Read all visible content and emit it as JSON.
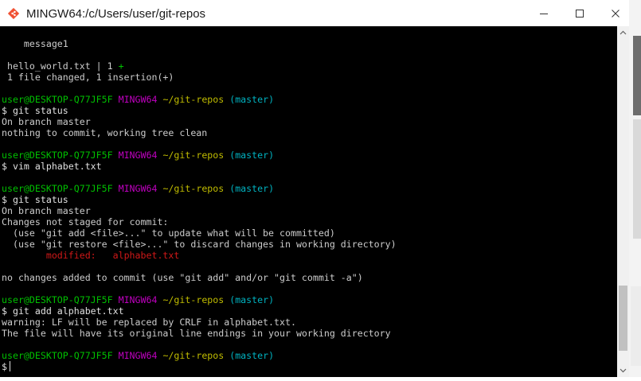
{
  "window": {
    "title": "MINGW64:/c/Users/user/git-repos",
    "controls": {
      "minimize": "minimize",
      "maximize": "maximize",
      "close": "close"
    }
  },
  "colors": {
    "user_host": "#00c100",
    "mingw": "#c000c0",
    "path": "#c0bc00",
    "branch": "#00b2c0",
    "modified": "#d01818"
  },
  "terminal": {
    "lines": [
      [
        {
          "t": "    message1",
          "c": ""
        }
      ],
      [
        {
          "t": "",
          "c": ""
        }
      ],
      [
        {
          "t": " hello_world.txt | 1 ",
          "c": ""
        },
        {
          "t": "+",
          "c": "c-green"
        }
      ],
      [
        {
          "t": " 1 file changed, 1 insertion(+)",
          "c": ""
        }
      ],
      [
        {
          "t": "",
          "c": ""
        }
      ],
      [
        {
          "t": "user@DESKTOP-Q77JF5F",
          "c": "c-green"
        },
        {
          "t": " ",
          "c": ""
        },
        {
          "t": "MINGW64",
          "c": "c-magenta"
        },
        {
          "t": " ",
          "c": ""
        },
        {
          "t": "~/git-repos",
          "c": "c-yellow"
        },
        {
          "t": " ",
          "c": ""
        },
        {
          "t": "(master)",
          "c": "c-cyan"
        }
      ],
      [
        {
          "t": "$ git status",
          "c": "c-white"
        }
      ],
      [
        {
          "t": "On branch master",
          "c": ""
        }
      ],
      [
        {
          "t": "nothing to commit, working tree clean",
          "c": ""
        }
      ],
      [
        {
          "t": "",
          "c": ""
        }
      ],
      [
        {
          "t": "user@DESKTOP-Q77JF5F",
          "c": "c-green"
        },
        {
          "t": " ",
          "c": ""
        },
        {
          "t": "MINGW64",
          "c": "c-magenta"
        },
        {
          "t": " ",
          "c": ""
        },
        {
          "t": "~/git-repos",
          "c": "c-yellow"
        },
        {
          "t": " ",
          "c": ""
        },
        {
          "t": "(master)",
          "c": "c-cyan"
        }
      ],
      [
        {
          "t": "$ vim alphabet.txt",
          "c": "c-white"
        }
      ],
      [
        {
          "t": "",
          "c": ""
        }
      ],
      [
        {
          "t": "user@DESKTOP-Q77JF5F",
          "c": "c-green"
        },
        {
          "t": " ",
          "c": ""
        },
        {
          "t": "MINGW64",
          "c": "c-magenta"
        },
        {
          "t": " ",
          "c": ""
        },
        {
          "t": "~/git-repos",
          "c": "c-yellow"
        },
        {
          "t": " ",
          "c": ""
        },
        {
          "t": "(master)",
          "c": "c-cyan"
        }
      ],
      [
        {
          "t": "$ git status",
          "c": "c-white"
        }
      ],
      [
        {
          "t": "On branch master",
          "c": ""
        }
      ],
      [
        {
          "t": "Changes not staged for commit:",
          "c": ""
        }
      ],
      [
        {
          "t": "  (use \"git add <file>...\" to update what will be committed)",
          "c": ""
        }
      ],
      [
        {
          "t": "  (use \"git restore <file>...\" to discard changes in working directory)",
          "c": ""
        }
      ],
      [
        {
          "t": "        ",
          "c": ""
        },
        {
          "t": "modified:   alphabet.txt",
          "c": "c-red"
        }
      ],
      [
        {
          "t": "",
          "c": ""
        }
      ],
      [
        {
          "t": "no changes added to commit (use \"git add\" and/or \"git commit -a\")",
          "c": ""
        }
      ],
      [
        {
          "t": "",
          "c": ""
        }
      ],
      [
        {
          "t": "user@DESKTOP-Q77JF5F",
          "c": "c-green"
        },
        {
          "t": " ",
          "c": ""
        },
        {
          "t": "MINGW64",
          "c": "c-magenta"
        },
        {
          "t": " ",
          "c": ""
        },
        {
          "t": "~/git-repos",
          "c": "c-yellow"
        },
        {
          "t": " ",
          "c": ""
        },
        {
          "t": "(master)",
          "c": "c-cyan"
        }
      ],
      [
        {
          "t": "$ git add alphabet.txt",
          "c": "c-white"
        }
      ],
      [
        {
          "t": "warning: LF will be replaced by CRLF in alphabet.txt.",
          "c": ""
        }
      ],
      [
        {
          "t": "The file will have its original line endings in your working directory",
          "c": ""
        }
      ],
      [
        {
          "t": "",
          "c": ""
        }
      ],
      [
        {
          "t": "user@DESKTOP-Q77JF5F",
          "c": "c-green"
        },
        {
          "t": " ",
          "c": ""
        },
        {
          "t": "MINGW64",
          "c": "c-magenta"
        },
        {
          "t": " ",
          "c": ""
        },
        {
          "t": "~/git-repos",
          "c": "c-yellow"
        },
        {
          "t": " ",
          "c": ""
        },
        {
          "t": "(master)",
          "c": "c-cyan"
        }
      ],
      [
        {
          "t": "$",
          "c": "c-white"
        }
      ]
    ]
  }
}
